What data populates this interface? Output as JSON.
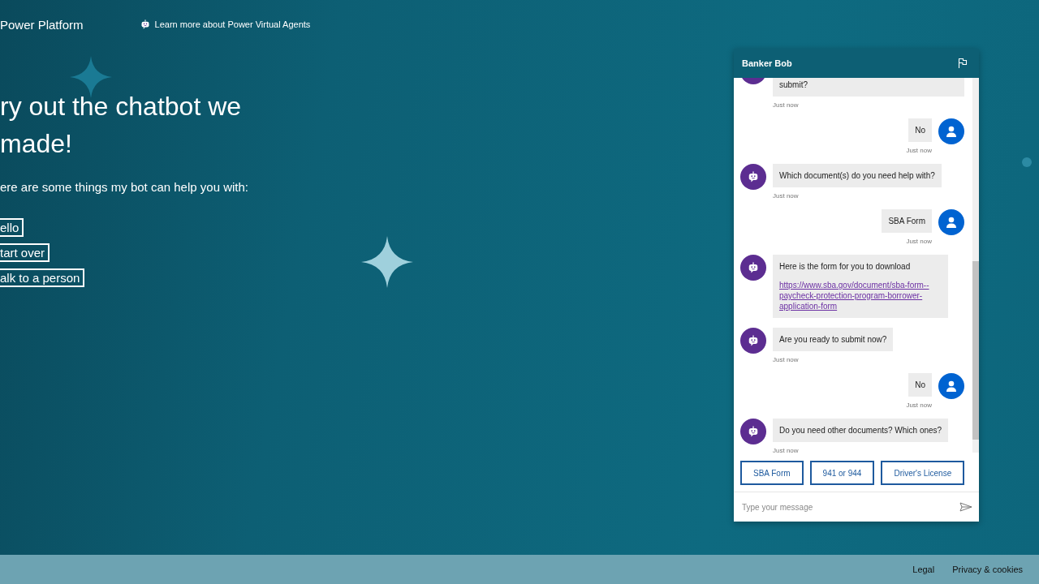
{
  "header": {
    "brand": "Power Platform",
    "learn_link": "Learn more about Power Virtual Agents"
  },
  "hero": {
    "title": "ry out the chatbot we made!",
    "intro": "ere are some things my bot can help you with:",
    "topics": [
      "ello",
      "tart over",
      "alk to a person"
    ]
  },
  "chat": {
    "title": "Banker Bob",
    "messages": [
      {
        "kind": "bot",
        "text": "submit?",
        "time": "Just now"
      },
      {
        "kind": "user",
        "text": "No",
        "time": "Just now"
      },
      {
        "kind": "bot",
        "text": "Which document(s) do you need help with?",
        "time": "Just now"
      },
      {
        "kind": "user",
        "text": "SBA Form",
        "time": "Just now"
      },
      {
        "kind": "bot",
        "text": "Here is the form for you to download",
        "link": "https://www.sba.gov/document/sba-form--paycheck-protection-program-borrower-application-form"
      },
      {
        "kind": "bot",
        "text": "Are you ready to submit now?",
        "time": "Just now"
      },
      {
        "kind": "user",
        "text": "No",
        "time": "Just now"
      },
      {
        "kind": "bot",
        "text": "Do you need other documents? Which ones?",
        "time": "Just now"
      }
    ],
    "suggestions": [
      "SBA Form",
      "941 or 944",
      "Driver's License"
    ],
    "input": {
      "placeholder": "Type your message"
    }
  },
  "footer": {
    "links": [
      "Legal",
      "Privacy & cookies"
    ]
  }
}
